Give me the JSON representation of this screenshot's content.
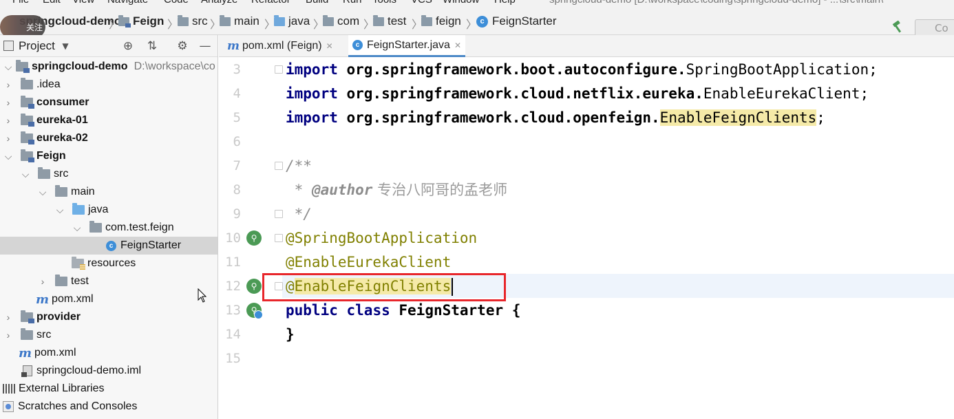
{
  "menubar": {
    "items": [
      "File",
      "Edit",
      "View",
      "Navigate",
      "Code",
      "Analyze",
      "Refactor",
      "Build",
      "Run",
      "Tools",
      "VCS",
      "Window",
      "Help"
    ],
    "title_text": "springcloud-demo [D:\\workspace\\coding\\springcloud-demo] - ...\\src\\main\\"
  },
  "breadcrumb": {
    "avatar_label": "关注",
    "items": [
      "springcloud-demo",
      "Feign",
      "src",
      "main",
      "java",
      "com",
      "test",
      "feign",
      "FeignStarter"
    ],
    "run_config": "Co"
  },
  "project_panel": {
    "title": "Project",
    "tree": [
      {
        "label": "springcloud-demo",
        "extra": "D:\\workspace\\co"
      },
      {
        "label": ".idea"
      },
      {
        "label": "consumer"
      },
      {
        "label": "eureka-01"
      },
      {
        "label": "eureka-02"
      },
      {
        "label": "Feign"
      },
      {
        "label": "src"
      },
      {
        "label": "main"
      },
      {
        "label": "java"
      },
      {
        "label": "com.test.feign"
      },
      {
        "label": "FeignStarter"
      },
      {
        "label": "resources"
      },
      {
        "label": "test"
      },
      {
        "label": "pom.xml"
      },
      {
        "label": "provider"
      },
      {
        "label": "src"
      },
      {
        "label": "pom.xml"
      },
      {
        "label": "springcloud-demo.iml"
      },
      {
        "label": "External Libraries"
      },
      {
        "label": "Scratches and Consoles"
      }
    ]
  },
  "tabs": [
    {
      "label": "pom.xml (Feign)",
      "icon": "maven-icon"
    },
    {
      "label": "FeignStarter.java",
      "icon": "java-class-icon"
    }
  ],
  "editor": {
    "line_numbers": [
      "3",
      "4",
      "5",
      "6",
      "7",
      "8",
      "9",
      "10",
      "11",
      "12",
      "13",
      "14",
      "15"
    ],
    "lines": {
      "l3": {
        "kw": "import",
        "pkg": "org.springframework.boot.autoconfigure.",
        "cls": "SpringBootApplication",
        "end": ";"
      },
      "l4": {
        "kw": "import",
        "pkg": "org.springframework.cloud.netflix.eureka.",
        "cls": "EnableEurekaClient",
        "end": ";"
      },
      "l5": {
        "kw": "import",
        "pkg": "org.springframework.cloud.openfeign.",
        "cls": "EnableFeignClients",
        "end": ";"
      },
      "l7": "/**",
      "l8": {
        "prefix": " * ",
        "tag": "@author",
        "text": " 专治八阿哥的孟老师"
      },
      "l9": " */",
      "l10": "@SpringBootApplication",
      "l11": "@EnableEurekaClient",
      "l12": {
        "at": "@",
        "name": "EnableFeignClients"
      },
      "l13": {
        "kw1": "public",
        "kw2": "class",
        "name": "FeignStarter",
        "brace": " {"
      },
      "l14": "}"
    }
  },
  "colors": {
    "keyword": "#000080",
    "highlight": "#f5eaa8",
    "annotation_box": "#e8262b",
    "current_line": "#eef4fc",
    "tab_underline": "#4a88c7"
  }
}
